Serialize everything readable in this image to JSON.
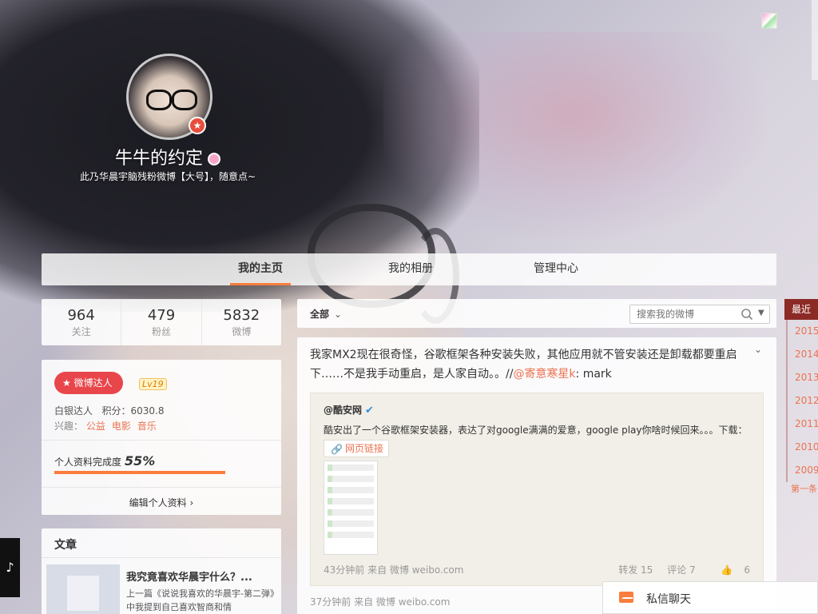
{
  "profile": {
    "name": "牛牛的约定",
    "bio": "此乃华晨宇脑残粉微博【大号】，随意点~"
  },
  "nav": {
    "tabs": [
      "我的主页",
      "我的相册",
      "管理中心"
    ]
  },
  "stats": [
    {
      "value": "964",
      "label": "关注"
    },
    {
      "value": "479",
      "label": "粉丝"
    },
    {
      "value": "5832",
      "label": "微博"
    }
  ],
  "card": {
    "talent_label": "微博达人",
    "level": "Lv19",
    "rank": "白银达人",
    "points_label": "积分：",
    "points": "6030.8",
    "interest_label": "兴趣：",
    "interests": [
      "公益",
      "电影",
      "音乐"
    ],
    "completion_label": "个人资料完成度",
    "completion_value": "55%",
    "completion_fraction": 0.8,
    "edit_label": "编辑个人资料"
  },
  "article": {
    "section_title": "文章",
    "headline": "我究竟喜欢华晨宇什么？...",
    "description": "上一篇《说说我喜欢的华晨宇-第二弹》中我提到自己喜欢智商和情"
  },
  "feed": {
    "filter_label": "全部",
    "search_placeholder": "搜索我的微博",
    "post": {
      "text_main": "我家MX2现在很奇怪，谷歌框架各种安装失败，其他应用就不管安装还是卸载都要重启下……不是我手动重启，是人家自动。。//",
      "mention": "@寄意寒星k",
      "text_tail": ": mark",
      "repost_author": "@酷安网",
      "repost_text": "酷安出了一个谷歌框架安装器，表达了对google满满的爱意，google play你啥时候回来。。。下载：",
      "link_label": "网页链接",
      "repost_meta": "43分钟前 来自 微博 weibo.com",
      "repost_forward": "转发 15",
      "repost_comment": "评论 7",
      "repost_like": "6",
      "post_meta": "37分钟前 来自 微博 weibo.com"
    }
  },
  "timeline": {
    "recent": "最近",
    "years": [
      "2015",
      "2014",
      "2013",
      "2012",
      "2011",
      "2010",
      "2009"
    ],
    "first": "第一条"
  },
  "chat": {
    "label": "私信聊天"
  },
  "colors": {
    "accent": "#fa7d3c",
    "link": "#eb7350",
    "talent": "#e8464b",
    "timeline": "#8c2a26"
  }
}
